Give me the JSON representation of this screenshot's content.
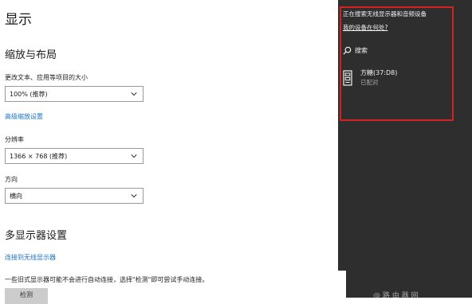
{
  "display": {
    "title": "显示",
    "scale_section": {
      "title": "缩放与布局",
      "text_size_label": "更改文本、应用等项目的大小",
      "text_size_value": "100% (推荐)",
      "advanced_scaling_link": "高级缩放设置",
      "resolution_label": "分辨率",
      "resolution_value": "1366 × 768 (推荐)",
      "orientation_label": "方向",
      "orientation_value": "横向"
    },
    "multi_display": {
      "title": "多显示器设置",
      "connect_link": "连接到无线显示器",
      "help_text": "一些旧式显示器可能不会进行自动连接，选择\"检测\"即可尝试手动连接。",
      "detect_button": "检测"
    }
  },
  "connect_panel": {
    "heading": "正在搜索无线显示器和音频设备",
    "where_link": "我的设备在何处?",
    "search_label": "搜索",
    "device": {
      "name": "方糖(37:D8)",
      "status": "已配对"
    }
  },
  "watermark": "@ 路 由 器 网"
}
